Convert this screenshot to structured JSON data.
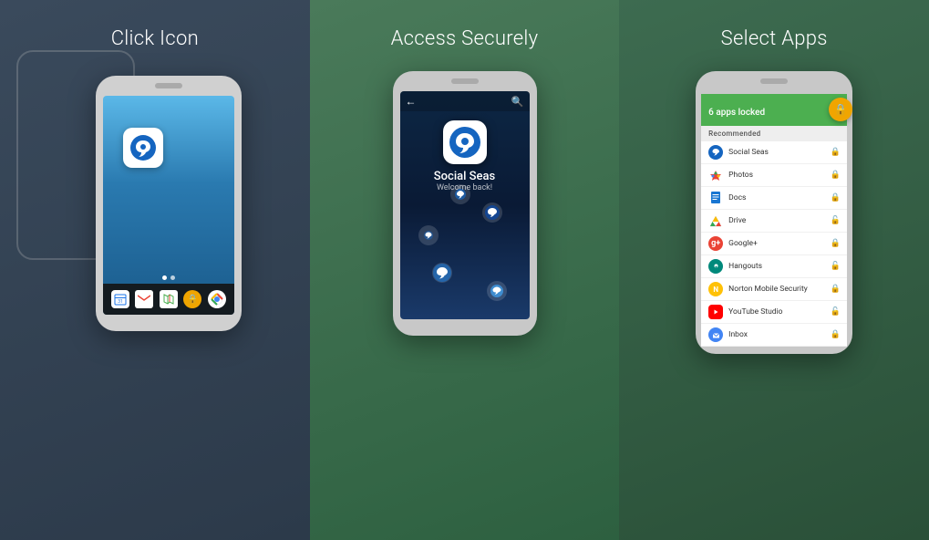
{
  "panel1": {
    "title": "Click Icon",
    "bottom_icons": [
      "📅",
      "✉",
      "🗺",
      "🔒",
      "◉"
    ]
  },
  "panel2": {
    "title": "Access Securely",
    "app_name": "Social Seas",
    "app_subtitle": "Welcome back!"
  },
  "panel3": {
    "title": "Select Apps",
    "apps_locked": "6 apps locked",
    "recommended_label": "Recommended",
    "apps": [
      {
        "name": "Social Seas",
        "locked": true,
        "color": "#1565C0"
      },
      {
        "name": "Photos",
        "locked": true,
        "color": "#EA4335"
      },
      {
        "name": "Docs",
        "locked": true,
        "color": "#1976D2"
      },
      {
        "name": "Drive",
        "locked": false,
        "color": "#4CAF50"
      },
      {
        "name": "Google+",
        "locked": true,
        "color": "#EA4335"
      },
      {
        "name": "Hangouts",
        "locked": false,
        "color": "#00897B"
      },
      {
        "name": "Norton Mobile Security",
        "locked": true,
        "color": "#FFC107"
      },
      {
        "name": "YouTube Studio",
        "locked": false,
        "color": "#FF0000"
      },
      {
        "name": "Inbox",
        "locked": true,
        "color": "#4285F4"
      }
    ]
  }
}
